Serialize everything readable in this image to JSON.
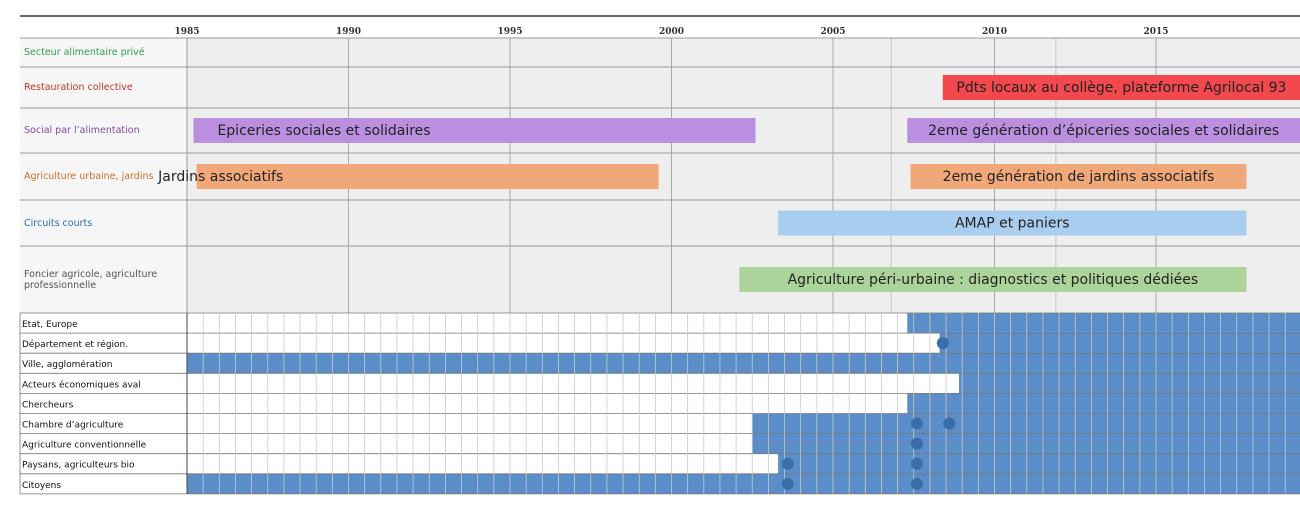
{
  "timeline": {
    "years": [
      "1985",
      "1990",
      "1995",
      "2000",
      "2005",
      "2010",
      "2015"
    ],
    "domains": [
      {
        "label": "Secteur alimentaire privé",
        "color": "#2e9e4f"
      },
      {
        "label": "Restauration collective",
        "color": "#c0392b"
      },
      {
        "label": "Social par l’alimentation",
        "color": "#7b4ea8"
      },
      {
        "label": "Agriculture urbaine, jardins",
        "color": "#c8702a"
      },
      {
        "label": "Circuits courts",
        "color": "#2c6fa8"
      },
      {
        "label": "Foncier agricole, agriculture professionnelle",
        "color": "#555555"
      }
    ],
    "bars": [
      {
        "row": 1,
        "start": 2008.4,
        "end": 2020.0,
        "label": "Pdts locaux au collège, plateforme Agrilocal 93",
        "color": "#f2484e"
      },
      {
        "row": 2,
        "start": 1985.2,
        "end": 2002.6,
        "label": "Epiceries sociales et solidaires",
        "color": "#bb8fdf"
      },
      {
        "row": 2,
        "start": 2007.3,
        "end": 2020.0,
        "label": "2eme génération d’épiceries sociales et solidaires",
        "color": "#bb8fdf"
      },
      {
        "row": 3,
        "start": 1985.3,
        "end": 1999.6,
        "label": "Jardins associatifs",
        "color": "#f0a878"
      },
      {
        "row": 3,
        "start": 2007.4,
        "end": 2017.8,
        "label": "2eme génération de jardins associatifs",
        "color": "#f0a878"
      },
      {
        "row": 4,
        "start": 2003.3,
        "end": 2017.8,
        "label": "AMAP et paniers",
        "color": "#a9cdee"
      },
      {
        "row": 5,
        "start": 2002.1,
        "end": 2017.8,
        "label": "Agriculture péri-urbaine : diagnostics et politiques dédiées",
        "color": "#acd49a"
      }
    ],
    "actors": [
      {
        "label": "Etat, Europe",
        "start": 2007.3
      },
      {
        "label": "Département et région.",
        "start": 2008.3
      },
      {
        "label": "Ville, agglomération",
        "start": 1985
      },
      {
        "label": "Acteurs économiques aval",
        "start": 2008.9
      },
      {
        "label": "Chercheurs",
        "start": 2007.3
      },
      {
        "label": "Chambre d’agriculture",
        "start": 2002.5
      },
      {
        "label": "Agriculture conventionnelle",
        "start": 2002.5
      },
      {
        "label": "Paysans, agriculteurs bio",
        "start": 2003.3
      },
      {
        "label": "Citoyens",
        "start": 1985
      }
    ],
    "dots": [
      {
        "row": 1,
        "year": 2008.4
      },
      {
        "row": 5,
        "year": 2007.6
      },
      {
        "row": 5,
        "year": 2008.6
      },
      {
        "row": 6,
        "year": 2007.6
      },
      {
        "row": 7,
        "year": 2003.6
      },
      {
        "row": 7,
        "year": 2007.6
      },
      {
        "row": 8,
        "year": 2003.6
      },
      {
        "row": 8,
        "year": 2007.6
      }
    ],
    "colors": {
      "actor_fill": "#5b8ec8",
      "dot": "#3a6ea8",
      "domain_bg": "#eeeeee"
    }
  }
}
